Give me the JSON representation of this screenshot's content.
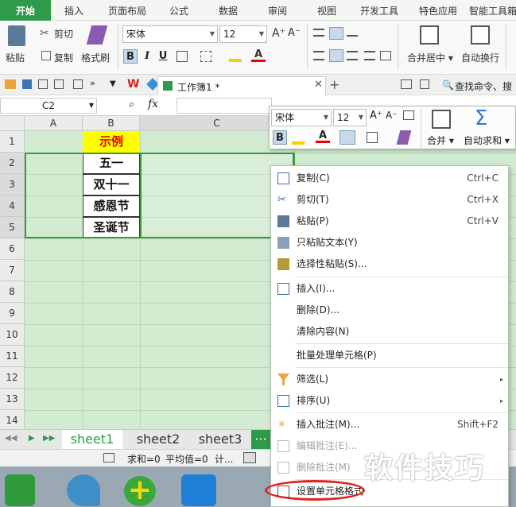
{
  "menu": {
    "tabs": [
      "开始",
      "插入",
      "页面布局",
      "公式",
      "数据",
      "审阅",
      "视图",
      "开发工具",
      "特色应用",
      "智能工具箱"
    ],
    "active": "开始"
  },
  "ribbon": {
    "paste": "粘贴",
    "cut": "剪切",
    "copy": "复制",
    "format_painter": "格式刷",
    "font": "宋体",
    "size": "12",
    "merge_center": "合并居中",
    "wrap_text": "自动换行",
    "fmt_bold": "B",
    "fmt_italic": "I",
    "fmt_underline": "U",
    "grow_font": "A⁺",
    "shrink_font": "A⁻",
    "font_color": "A"
  },
  "quickbar": {
    "doc_tab": "工作簿1 *",
    "search": "查找命令、搜"
  },
  "formula": {
    "cell_ref": "C2",
    "fx": "fx"
  },
  "grid": {
    "columns": [
      "A",
      "B",
      "C"
    ],
    "rows": [
      "1",
      "2",
      "3",
      "4",
      "5",
      "6",
      "7",
      "8",
      "9",
      "10",
      "11",
      "12",
      "13",
      "14"
    ],
    "cells": {
      "b1": "示例",
      "b2": "五一",
      "b3": "双十一",
      "b4": "感恩节",
      "b5": "圣诞节"
    }
  },
  "sheets": {
    "tabs": [
      "sheet1",
      "sheet2",
      "sheet3"
    ],
    "more": "···"
  },
  "status": {
    "sum": "求和=0",
    "avg": "平均值=0",
    "count": "计..."
  },
  "mini": {
    "font": "宋体",
    "size": "12",
    "merge": "合并",
    "autosum": "自动求和",
    "bold": "B",
    "font_color": "A",
    "sigma": "Σ"
  },
  "context_menu": {
    "copy": {
      "label": "复制(C)",
      "shortcut": "Ctrl+C"
    },
    "cut": {
      "label": "剪切(T)",
      "shortcut": "Ctrl+X"
    },
    "paste": {
      "label": "粘贴(P)",
      "shortcut": "Ctrl+V"
    },
    "paste_text": {
      "label": "只粘贴文本(Y)"
    },
    "paste_special": {
      "label": "选择性粘贴(S)..."
    },
    "insert": {
      "label": "插入(I)..."
    },
    "delete": {
      "label": "删除(D)..."
    },
    "clear": {
      "label": "清除内容(N)"
    },
    "batch": {
      "label": "批量处理单元格(P)"
    },
    "filter": {
      "label": "筛选(L)"
    },
    "sort": {
      "label": "排序(U)"
    },
    "insert_comment": {
      "label": "插入批注(M)...",
      "shortcut": "Shift+F2"
    },
    "edit_comment": {
      "label": "编辑批注(E)..."
    },
    "delete_comment": {
      "label": "删除批注(M)"
    },
    "format_cells": {
      "label": "设置单元格格式"
    }
  },
  "watermark": "软件技巧",
  "colors": {
    "accent": "#2f9a4a",
    "sheet_bg": "#d3ecd1",
    "header_fill": "#ffff00",
    "header_text": "#e00000",
    "highlight_oval": "#e0241c"
  }
}
